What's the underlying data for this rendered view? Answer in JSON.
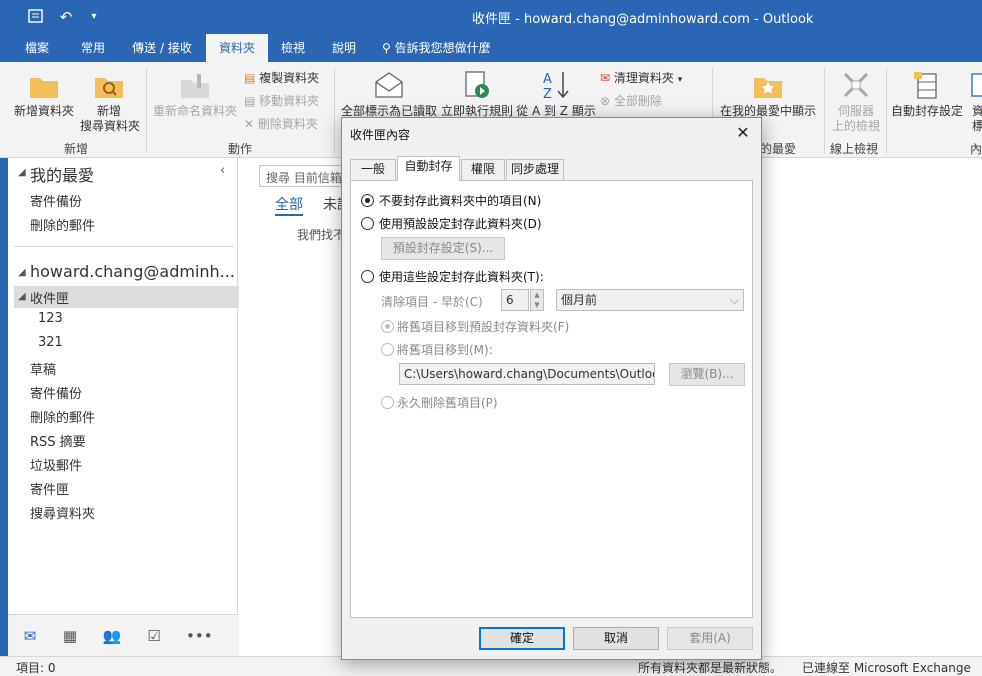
{
  "window": {
    "title": "收件匣 - howard.chang@adminhoward.com  -  Outlook"
  },
  "ribbon_tabs": [
    "檔案",
    "常用",
    "傳送 / 接收",
    "資料夾",
    "檢視",
    "說明"
  ],
  "tell_me": "告訴我您想做什麼",
  "ribbon": {
    "new_folder": "新增資料夾",
    "new_search_folder_1": "新增",
    "new_search_folder_2": "搜尋資料夾",
    "group_new": "新增",
    "rename_folder": "重新命名資料夾",
    "copy_folder": "複製資料夾",
    "move_folder": "移動資料夾",
    "delete_folder": "刪除資料夾",
    "group_actions": "動作",
    "mark_all_read": "全部標示為已讀取",
    "run_rules": "立即執行規則",
    "sort_az": "從 A 到 Z 顯示",
    "cleanup_folder": "清理資料夾",
    "delete_all": "全部刪除",
    "show_in_favorites": "在我的最愛中顯示",
    "group_favorites": "的最愛",
    "server_view_1": "伺服器",
    "server_view_2": "上的檢視",
    "group_online": "線上檢視",
    "auto_archive": "自動封存設定",
    "folder_props_1": "資",
    "folder_props_2": "標",
    "group_props": "內"
  },
  "folder_pane": {
    "favorites": "我的最愛",
    "fav_items": [
      "寄件備份",
      "刪除的郵件"
    ],
    "account": "howard.chang@adminh...",
    "inbox": "收件匣",
    "subfolders": [
      "123",
      "321"
    ],
    "folders": [
      "草稿",
      "寄件備份",
      "刪除的郵件",
      "RSS 摘要",
      "垃圾郵件",
      "寄件匣",
      "搜尋資料夾"
    ]
  },
  "message_list": {
    "search_placeholder": "搜尋 目前信箱",
    "tab_all": "全部",
    "tab_unread": "未讀",
    "empty": "我們找不"
  },
  "status": {
    "items": "項目: 0",
    "uptodate": "所有資料夾都是最新狀態。",
    "connected": "已連線至 Microsoft Exchange"
  },
  "dialog": {
    "title": "收件匣內容",
    "tabs": [
      "一般",
      "自動封存",
      "權限",
      "同步處理"
    ],
    "opt_no_archive": "不要封存此資料夾中的項目(N)",
    "opt_default": "使用預設設定封存此資料夾(D)",
    "default_settings_btn": "預設封存設定(S)...",
    "opt_custom": "使用這些設定封存此資料夾(T):",
    "clean_older": "清除項目 - 早於(C)",
    "age_value": "6",
    "age_unit": "個月前",
    "move_default": "將舊項目移到預設封存資料夾(F)",
    "move_to": "將舊項目移到(M):",
    "path": "C:\\Users\\howard.chang\\Documents\\Outlook",
    "browse": "瀏覽(B)...",
    "delete_perm": "永久刪除舊項目(P)",
    "ok": "確定",
    "cancel": "取消",
    "apply": "套用(A)"
  },
  "colors": {
    "accent": "#2a66b3",
    "ribbon_bg": "#f3f3f3",
    "folder_icon": "#f2c05a"
  }
}
